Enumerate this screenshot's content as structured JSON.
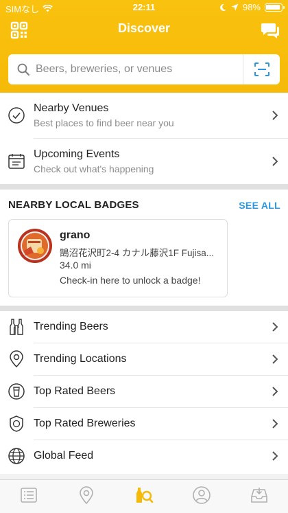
{
  "status_bar": {
    "carrier": "SIMなし",
    "time": "22:11",
    "battery": "98%"
  },
  "header": {
    "title": "Discover"
  },
  "search": {
    "placeholder": "Beers, breweries, or venues"
  },
  "discover_items": [
    {
      "title": "Nearby Venues",
      "subtitle": "Best places to find beer near you",
      "icon": "check-circle-icon"
    },
    {
      "title": "Upcoming Events",
      "subtitle": "Check out what's happening",
      "icon": "calendar-icon"
    }
  ],
  "badges": {
    "heading": "NEARBY LOCAL BADGES",
    "see_all": "SEE ALL",
    "card": {
      "name": "grano",
      "address": "鵠沼花沢町2-4 カナル藤沢1F Fujisa...",
      "distance": "34.0 mi",
      "cta": "Check-in here to unlock a badge!"
    }
  },
  "lists": [
    {
      "label": "Trending Beers",
      "icon": "bottles-icon"
    },
    {
      "label": "Trending Locations",
      "icon": "location-pin-icon"
    },
    {
      "label": "Top Rated Beers",
      "icon": "beer-glass-icon"
    },
    {
      "label": "Top Rated Breweries",
      "icon": "brewery-badge-icon"
    },
    {
      "label": "Global Feed",
      "icon": "globe-icon"
    }
  ],
  "tabbar": {
    "tabs": [
      "activity-feed-icon",
      "venues-pin-icon",
      "discover-search-icon",
      "profile-icon",
      "inbox-icon"
    ],
    "active_index": 2
  },
  "colors": {
    "brand_yellow": "#f9c20e",
    "accent_blue": "#2a97e0"
  }
}
